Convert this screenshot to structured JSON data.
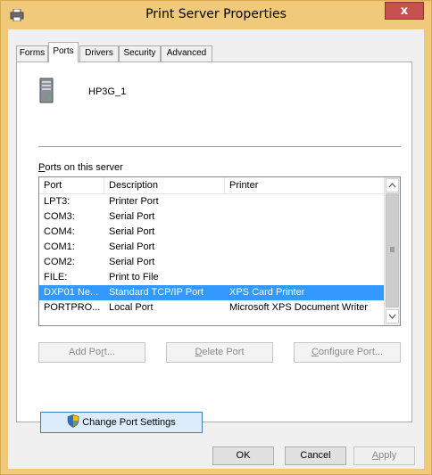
{
  "window": {
    "title": "Print Server Properties",
    "close_glyph": "x"
  },
  "tabs": [
    {
      "label": "Forms"
    },
    {
      "label": "Ports"
    },
    {
      "label": "Drivers"
    },
    {
      "label": "Security"
    },
    {
      "label": "Advanced"
    }
  ],
  "active_tab": "Ports",
  "server": {
    "name": "HP3G_1",
    "icon": "server-tower-icon"
  },
  "ports_label": {
    "prefix": "P",
    "rest": "orts on this server"
  },
  "ports_list": {
    "columns": [
      "Port",
      "Description",
      "Printer"
    ],
    "rows": [
      {
        "port": "LPT3:",
        "description": "Printer Port",
        "printer": ""
      },
      {
        "port": "COM3:",
        "description": "Serial Port",
        "printer": ""
      },
      {
        "port": "COM4:",
        "description": "Serial Port",
        "printer": ""
      },
      {
        "port": "COM1:",
        "description": "Serial Port",
        "printer": ""
      },
      {
        "port": "COM2:",
        "description": "Serial Port",
        "printer": ""
      },
      {
        "port": "FILE:",
        "description": "Print to File",
        "printer": ""
      },
      {
        "port": "DXP01 Ne...",
        "description": "Standard TCP/IP Port",
        "printer": "XPS Card Printer",
        "selected": true
      },
      {
        "port": "PORTPRO...",
        "description": "Local Port",
        "printer": "Microsoft XPS Document Writer"
      }
    ]
  },
  "buttons": {
    "add_port": {
      "pre": "Add Po",
      "u": "r",
      "post": "t..."
    },
    "delete_port": {
      "pre": "",
      "u": "D",
      "post": "elete Port"
    },
    "configure_port": {
      "pre": "",
      "u": "C",
      "post": "onfigure Port..."
    },
    "change_port_settings": {
      "pre": "Chan",
      "u": "g",
      "post": "e Port Settings"
    },
    "ok": "OK",
    "cancel": "Cancel",
    "apply": {
      "pre": "",
      "u": "A",
      "post": "pply"
    }
  },
  "colors": {
    "title_bar": "#f0c97a",
    "close_button": "#c75050",
    "selection": "#3399ff"
  }
}
